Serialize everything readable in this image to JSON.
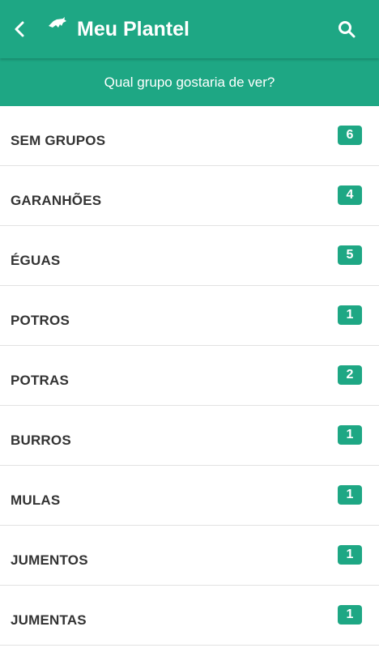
{
  "header": {
    "title": "Meu Plantel",
    "subtitle": "Qual grupo gostaria de ver?",
    "back_icon": "chevron-left-icon",
    "logo_icon": "horse-logo-icon",
    "search_icon": "search-icon"
  },
  "colors": {
    "primary": "#1ea784",
    "text": "#333333",
    "divider": "#e2e2e2"
  },
  "groups": [
    {
      "label": "SEM GRUPOS",
      "count": "6"
    },
    {
      "label": "GARANHÕES",
      "count": "4"
    },
    {
      "label": "ÉGUAS",
      "count": "5"
    },
    {
      "label": "POTROS",
      "count": "1"
    },
    {
      "label": "POTRAS",
      "count": "2"
    },
    {
      "label": "BURROS",
      "count": "1"
    },
    {
      "label": "MULAS",
      "count": "1"
    },
    {
      "label": "JUMENTOS",
      "count": "1"
    },
    {
      "label": "JUMENTAS",
      "count": "1"
    }
  ]
}
